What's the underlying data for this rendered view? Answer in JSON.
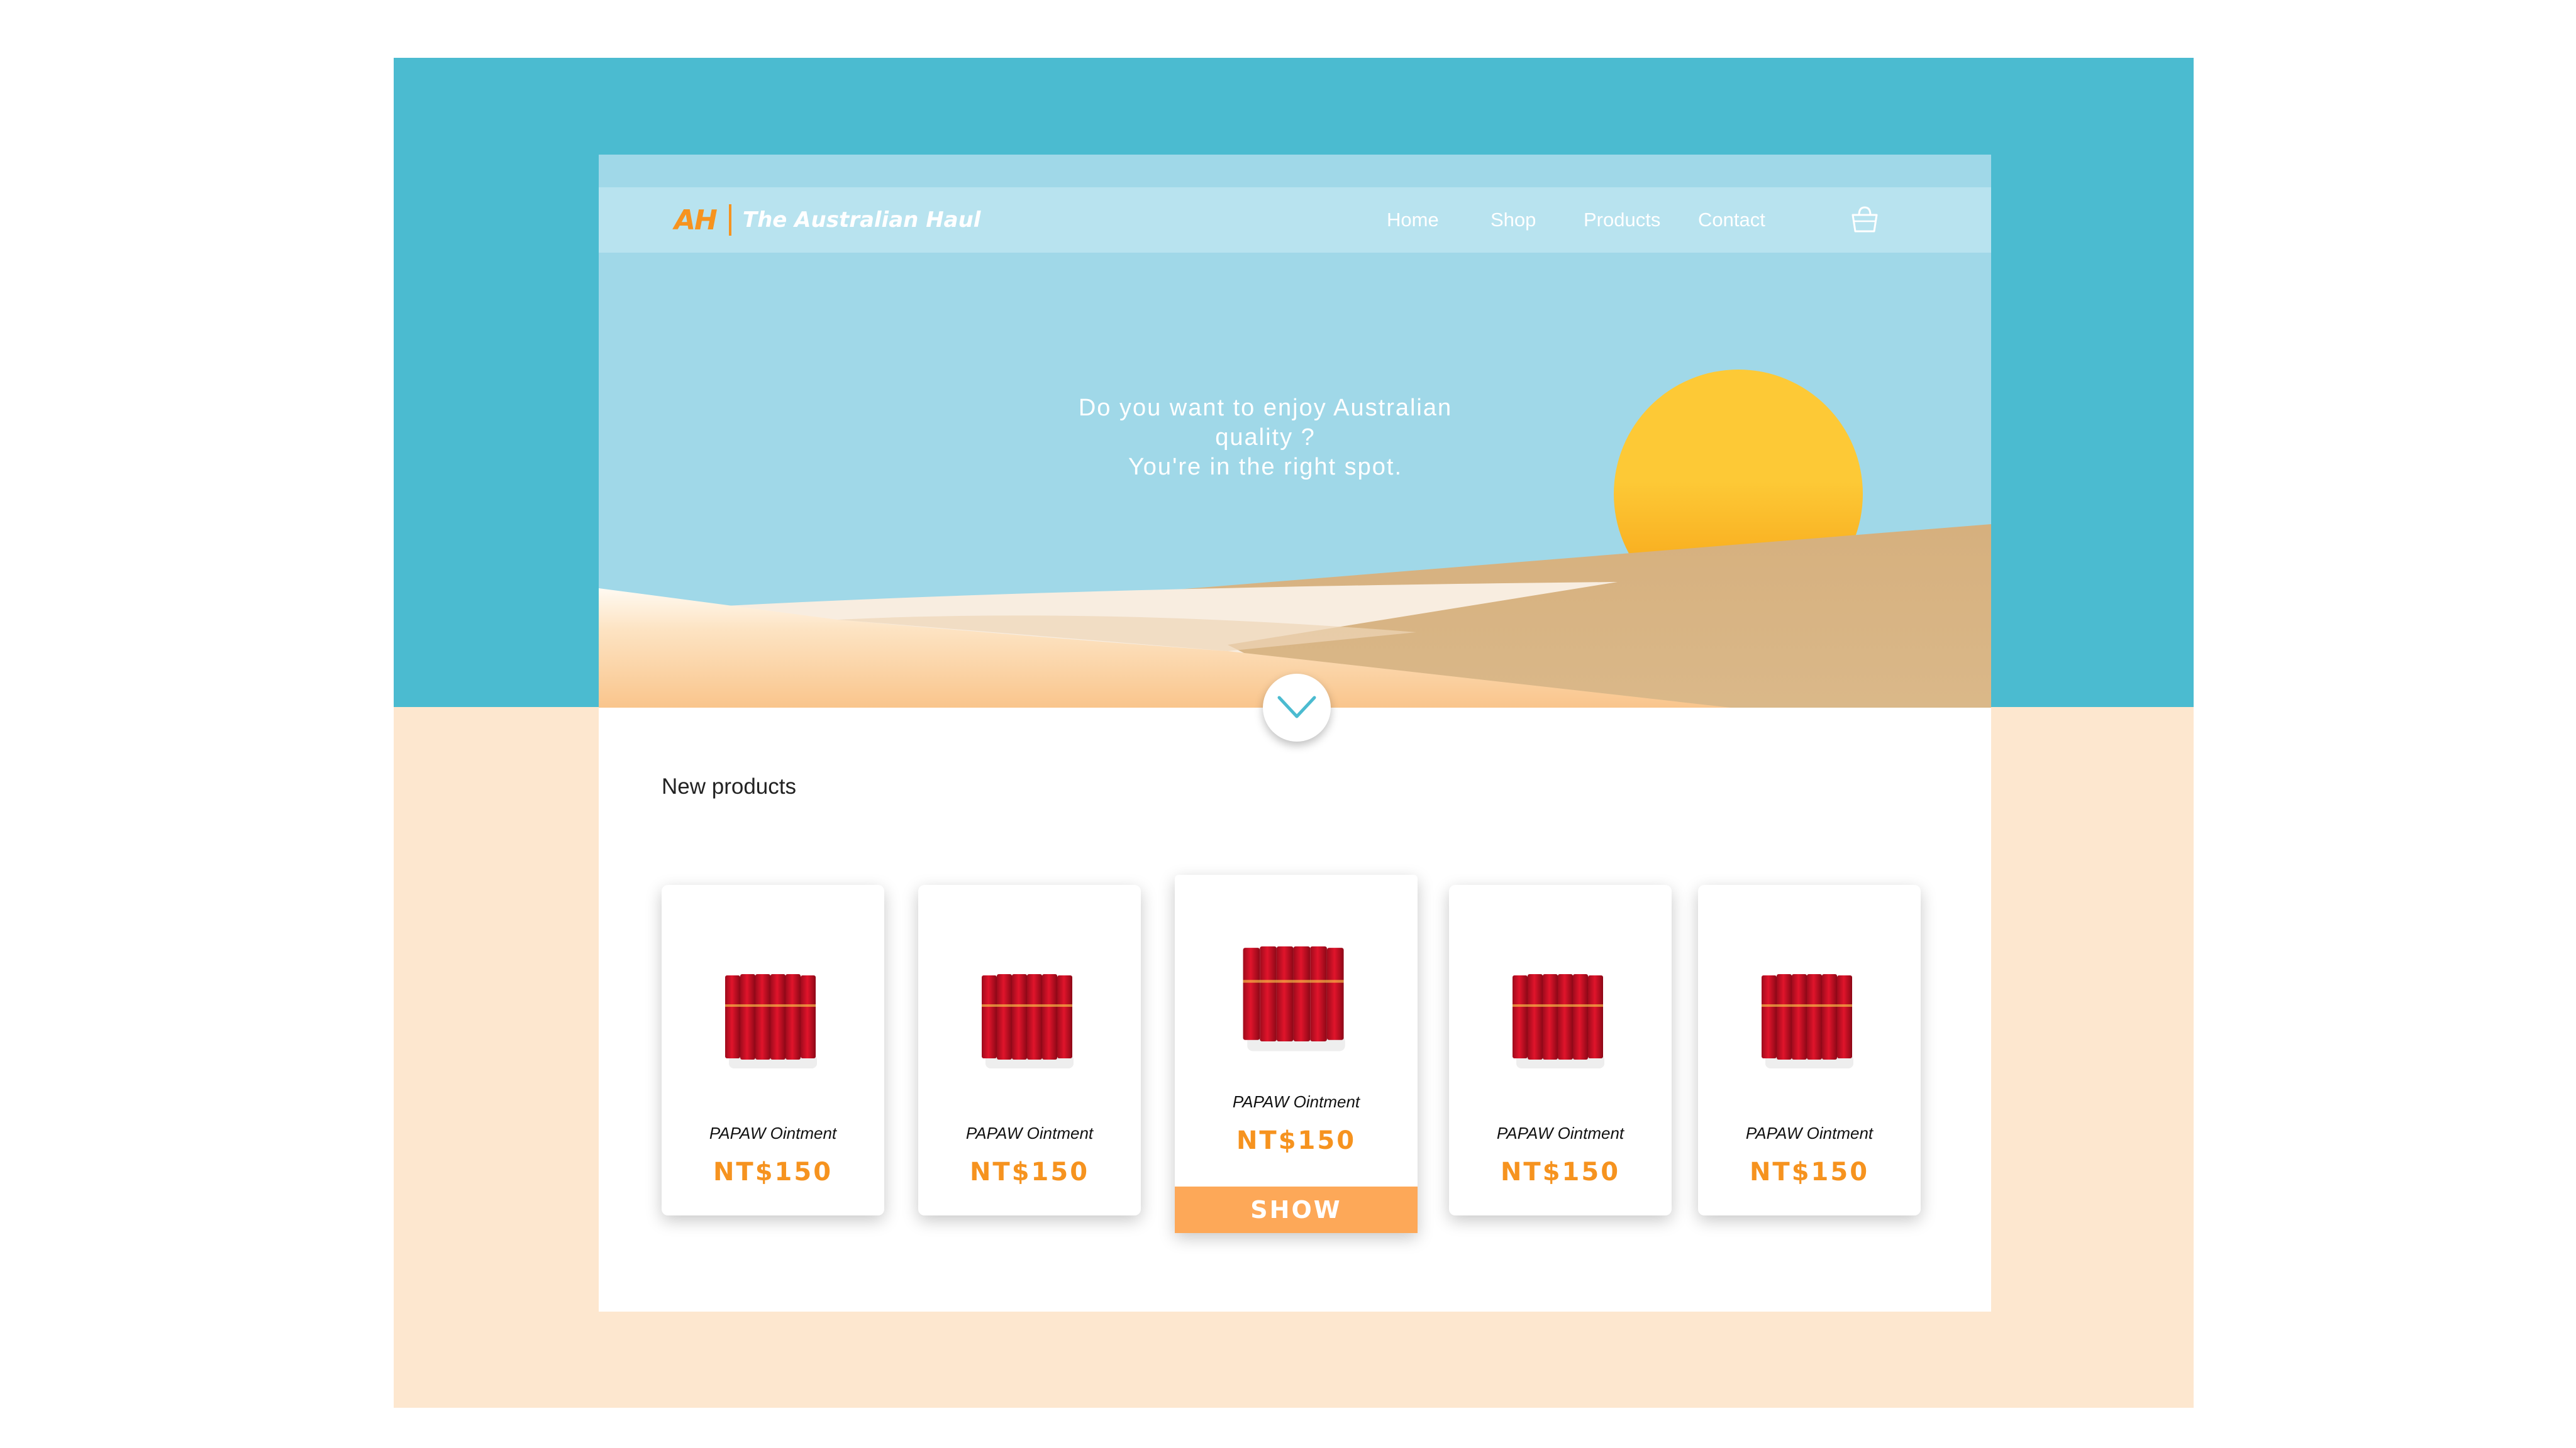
{
  "brand": {
    "logo_mark": "AH",
    "name": "The Australian Haul"
  },
  "nav": {
    "items": [
      {
        "label": "Home"
      },
      {
        "label": "Shop"
      },
      {
        "label": "Products"
      },
      {
        "label": "Contact"
      }
    ],
    "cart_icon": "shopping-basket-icon"
  },
  "hero": {
    "line1": "Do you want to enjoy Australian",
    "line2": "quality ?",
    "line3": "You're in the right spot.",
    "scroll_icon": "chevron-down-icon"
  },
  "products_section": {
    "title": "New products",
    "items": [
      {
        "name": "PAPAW Ointment",
        "price": "NT$150"
      },
      {
        "name": "PAPAW Ointment",
        "price": "NT$150"
      },
      {
        "name": "PAPAW Ointment",
        "price": "NT$150",
        "cta": "SHOW"
      },
      {
        "name": "PAPAW Ointment",
        "price": "NT$150"
      },
      {
        "name": "PAPAW Ointment",
        "price": "NT$150"
      }
    ]
  },
  "colors": {
    "frame_blue": "#4bbbd0",
    "frame_peach": "#fde7cf",
    "sky": "#a0d8e8",
    "accent_orange": "#f6931f",
    "button_orange": "#fda858",
    "sun_top": "#fdc936",
    "sun_bottom": "#f7a712",
    "sand": "#d7b384"
  }
}
